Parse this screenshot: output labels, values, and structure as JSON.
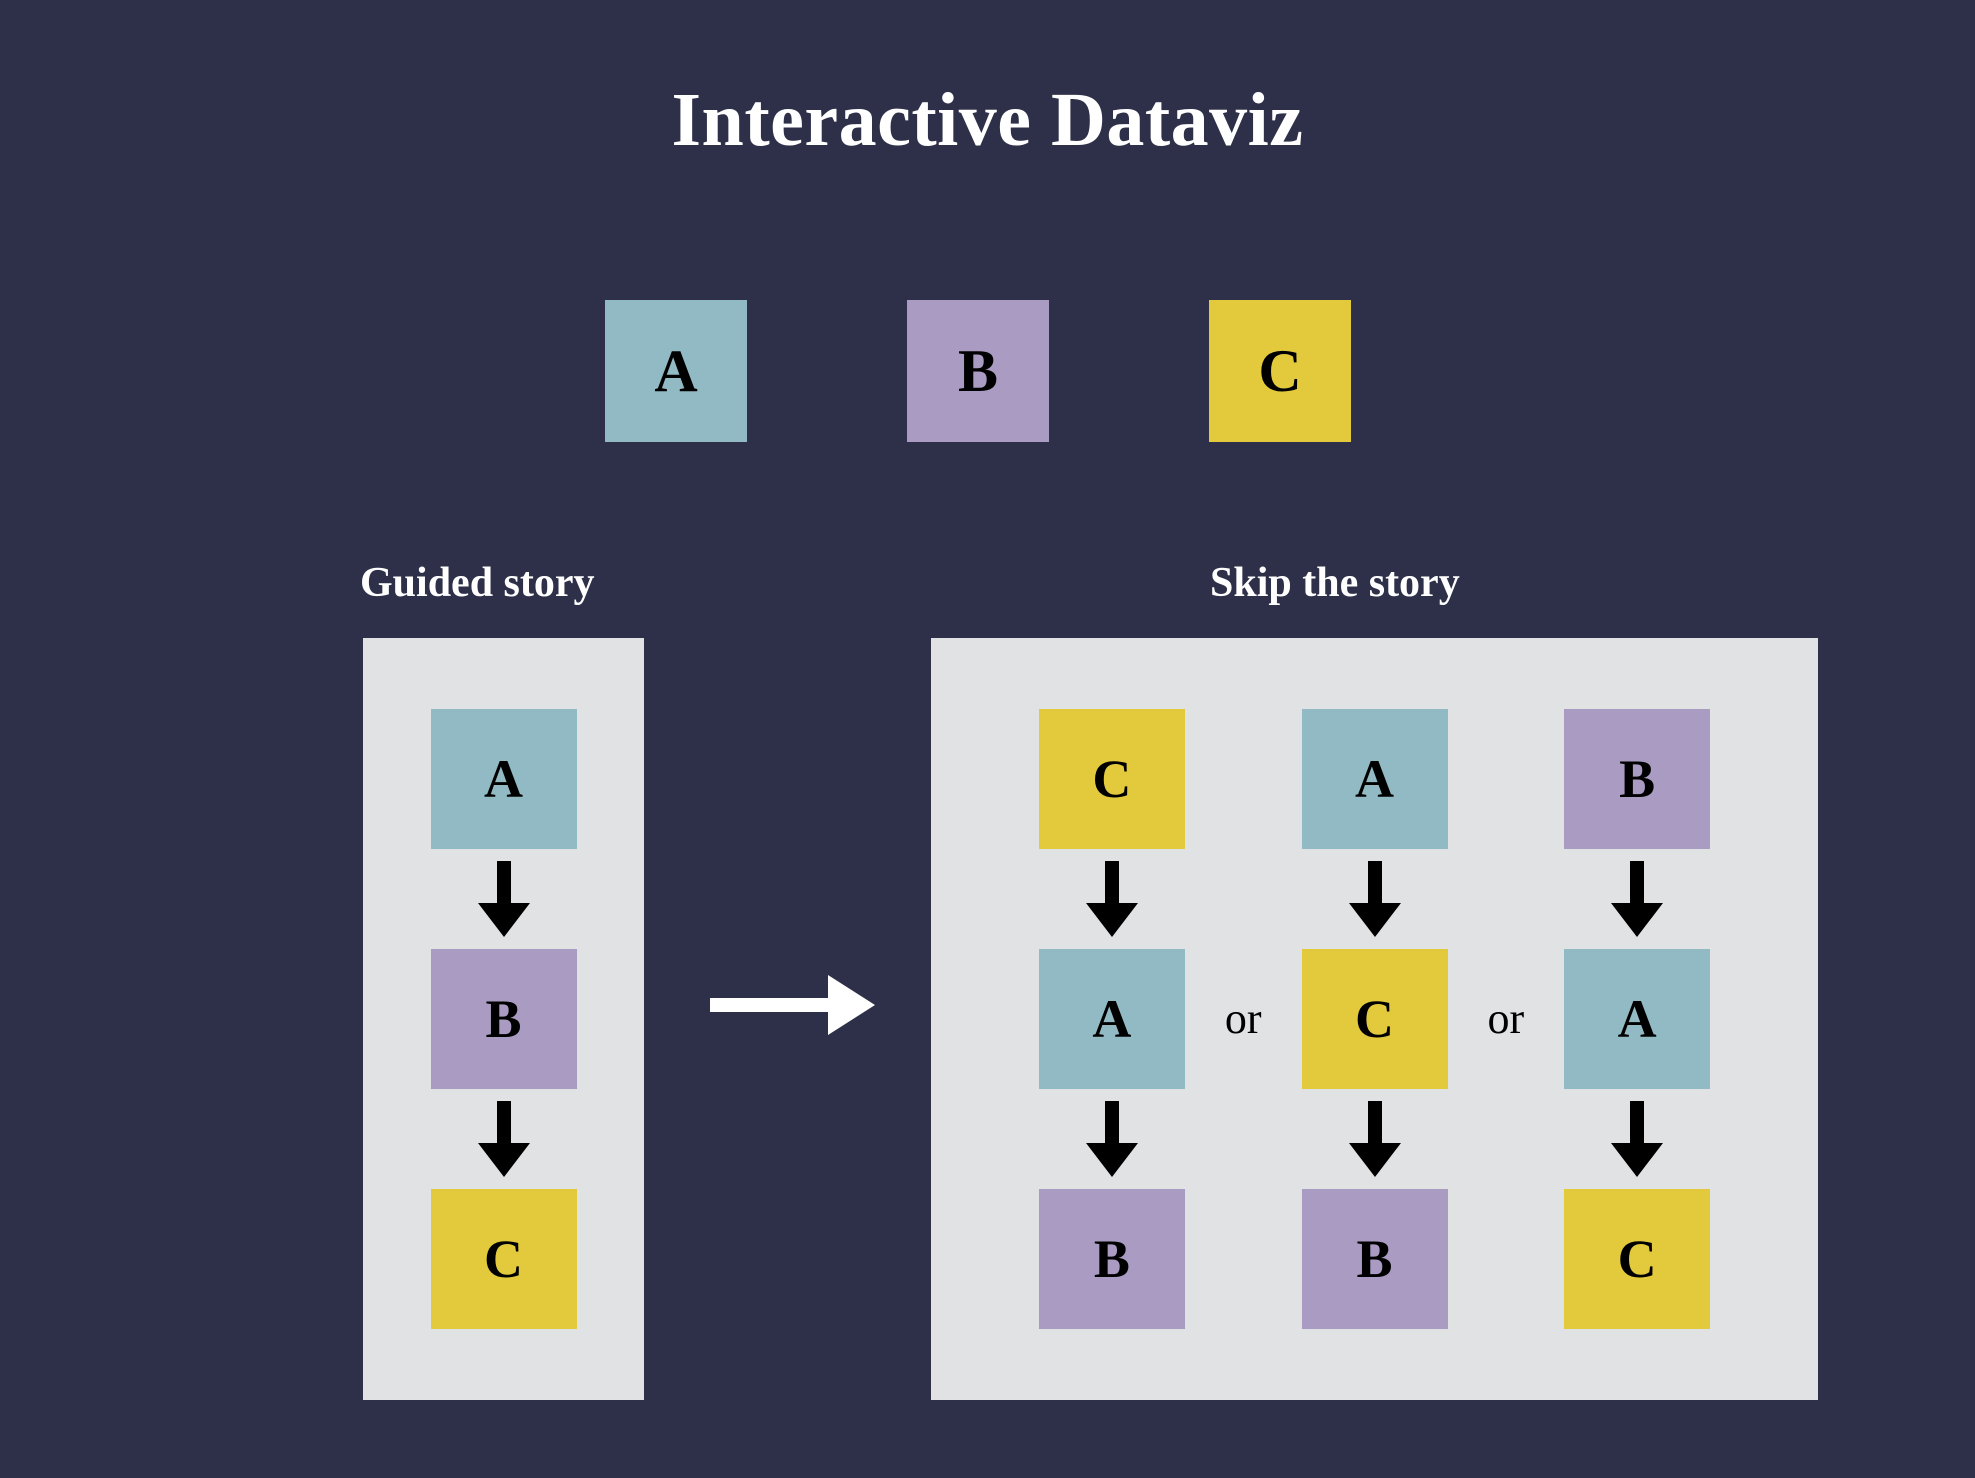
{
  "page": {
    "title": "Interactive Dataviz",
    "background_color": "#2e3049",
    "panel_color": "#e1e2e4",
    "title_color": "#ffffff",
    "node_text_color": "#000000"
  },
  "colors": {
    "A": "#91bac4",
    "B": "#a99bc1",
    "C": "#e2ca3c"
  },
  "legend": {
    "items": [
      {
        "label": "A",
        "color": "#91bac4"
      },
      {
        "label": "B",
        "color": "#a99bc1"
      },
      {
        "label": "C",
        "color": "#e2ca3c"
      }
    ]
  },
  "sections": {
    "guided": {
      "label": "Guided story",
      "chain": [
        {
          "label": "A",
          "color": "#91bac4"
        },
        {
          "label": "B",
          "color": "#a99bc1"
        },
        {
          "label": "C",
          "color": "#e2ca3c"
        }
      ]
    },
    "skip": {
      "label": "Skip the story",
      "separator": "or",
      "chains": [
        [
          {
            "label": "C",
            "color": "#e2ca3c"
          },
          {
            "label": "A",
            "color": "#91bac4"
          },
          {
            "label": "B",
            "color": "#a99bc1"
          }
        ],
        [
          {
            "label": "A",
            "color": "#91bac4"
          },
          {
            "label": "C",
            "color": "#e2ca3c"
          },
          {
            "label": "B",
            "color": "#a99bc1"
          }
        ],
        [
          {
            "label": "B",
            "color": "#a99bc1"
          },
          {
            "label": "A",
            "color": "#91bac4"
          },
          {
            "label": "C",
            "color": "#e2ca3c"
          }
        ]
      ]
    }
  },
  "icons": {
    "down_arrow": "down-arrow-icon",
    "transition_arrow": "right-arrow-icon"
  }
}
